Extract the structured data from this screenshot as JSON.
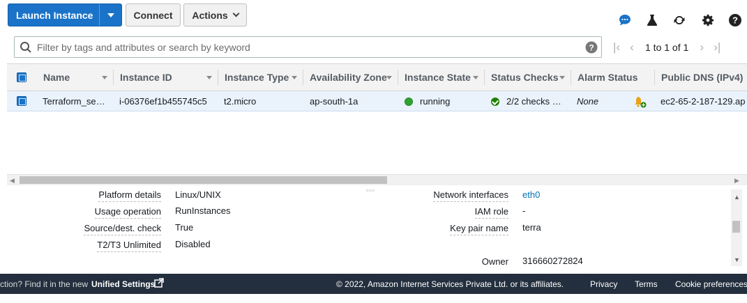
{
  "toolbar": {
    "launch_label": "Launch Instance",
    "connect_label": "Connect",
    "actions_label": "Actions",
    "icons": [
      "chat-icon",
      "flask-icon",
      "refresh-icon",
      "gear-icon",
      "help-icon"
    ]
  },
  "search": {
    "placeholder": "Filter by tags and attributes or search by keyword"
  },
  "pager": {
    "range_label": "1 to 1 of 1"
  },
  "table": {
    "columns": [
      "Name",
      "Instance ID",
      "Instance Type",
      "Availability Zone",
      "Instance State",
      "Status Checks",
      "Alarm Status",
      "Public DNS (IPv4)"
    ],
    "rows": [
      {
        "name": "Terraform_se…",
        "instance_id": "i-06376ef1b455745c5",
        "instance_type": "t2.micro",
        "availability_zone": "ap-south-1a",
        "instance_state": "running",
        "status_checks": "2/2 checks …",
        "alarm_status": "None",
        "public_dns": "ec2-65-2-187-129.ap"
      }
    ]
  },
  "details": {
    "left": [
      {
        "label": "Platform details",
        "value": "Linux/UNIX"
      },
      {
        "label": "Usage operation",
        "value": "RunInstances"
      },
      {
        "label": "Source/dest. check",
        "value": "True"
      },
      {
        "label": "T2/T3 Unlimited",
        "value": "Disabled"
      }
    ],
    "right": [
      {
        "label": "Network interfaces",
        "value": "eth0"
      },
      {
        "label": "IAM role",
        "value": "-"
      },
      {
        "label": "Key pair name",
        "value": "terra"
      },
      {
        "label": "Owner",
        "value": "316660272824"
      }
    ]
  },
  "footer": {
    "left_text": "ction? Find it in the new",
    "unified_settings": "Unified Settings",
    "copyright": "© 2022, Amazon Internet Services Private Ltd. or its affiliates.",
    "privacy": "Privacy",
    "terms": "Terms",
    "cookies": "Cookie preferences"
  },
  "colors": {
    "primary": "#1a73c8",
    "running": "#2fa32f",
    "footer_bg": "#232f3e",
    "selected_row": "#eaf3fc"
  }
}
